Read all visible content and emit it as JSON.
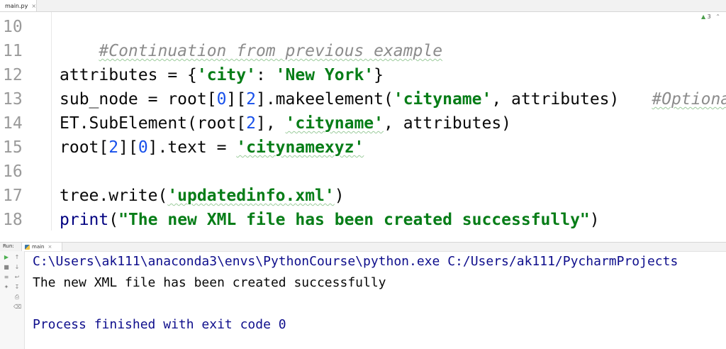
{
  "editor": {
    "tab": {
      "filename": "main.py",
      "close_icon": "×"
    },
    "inspection": {
      "icon": "warning-check",
      "count": "3"
    },
    "line_numbers": [
      "10",
      "11",
      "12",
      "13",
      "14",
      "15",
      "16",
      "17",
      "18"
    ],
    "code": {
      "l10": {
        "comment": "#Continuation from previous example"
      },
      "l12": {
        "a": "attributes = {",
        "s1": "'city'",
        "b": ": ",
        "s2": "'New York'",
        "c": "}"
      },
      "l13": {
        "a": "sub_node = root[",
        "n1": "0",
        "b": "][",
        "n2": "2",
        "c": "].makeelement(",
        "s1": "'cityname'",
        "d": ", attributes)",
        "comment": "#Optional"
      },
      "l14": {
        "a": "ET.SubElement(root[",
        "n1": "2",
        "b": "], ",
        "s1": "'cityname'",
        "c": ", attributes)"
      },
      "l15": {
        "a": "root[",
        "n1": "2",
        "b": "][",
        "n2": "0",
        "c": "].text = ",
        "s1": "'citynamexyz'"
      },
      "l17": {
        "a": "tree.write(",
        "s1": "'updatedinfo.xml'",
        "b": ")"
      },
      "l18": {
        "fn": "print",
        "a": "(",
        "s1": "\"The new XML file has been created successfully\"",
        "b": ")"
      }
    }
  },
  "run": {
    "label": "Run:",
    "tab_label": "main",
    "close_icon": "×",
    "console": {
      "command": "C:\\Users\\ak111\\anaconda3\\envs\\PythonCourse\\python.exe C:/Users/ak111/PycharmProjects",
      "output": "The new XML file has been created successfully",
      "exit": "Process finished with exit code 0"
    }
  }
}
